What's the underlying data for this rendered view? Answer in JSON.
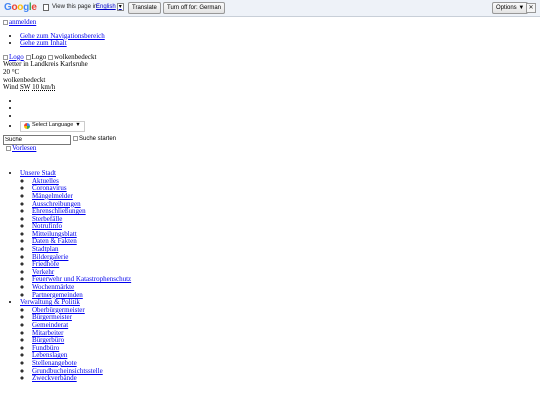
{
  "translate_bar": {
    "logo": "Google",
    "prompt": "View this page in:",
    "language": "English",
    "translate_button": "Translate",
    "turn_off_button": "Turn off for: German",
    "options_button": "Options ▼",
    "close": "✕"
  },
  "top": {
    "login_alt": "anmelden",
    "skip_links": [
      "Gehe zum Navigationsbereich",
      "Gehe zum Inhalt"
    ],
    "logo_alt_1": "Logo",
    "logo_alt_2": "Logo"
  },
  "weather": {
    "icon_alt": "wolkenbedeckt",
    "location": "Wetter in Landkreis Karlsruhe",
    "temperature": "20 °C",
    "condition": "wolkenbedeckt",
    "wind_label": "Wind",
    "wind_dir": "SW",
    "wind_speed": "10 km/h"
  },
  "language_selector": {
    "label": "Select Language",
    "arrow": "▼"
  },
  "search": {
    "value": "Suche",
    "button_alt": "Suche starten"
  },
  "readspeaker_alt": "Vorlesen",
  "nav": {
    "section1": {
      "label": "Unsere Stadt",
      "items": [
        "Aktuelles",
        "Coronavirus",
        "Mängelmelder",
        "Ausschreibungen",
        "Ehrenschließungen",
        "Sterbefälle",
        "Notrufinfo",
        "Mitteilungsblatt",
        "Daten & Fakten",
        "Stadtplan",
        "Bildergalerie",
        "Friedhöfe",
        "Verkehr",
        "Feuerwehr und Katastrophenschutz",
        "Wochenmärkte",
        "Partnergemeinden"
      ]
    },
    "section2": {
      "label": "Verwaltung & Politik",
      "items": [
        "Oberbürgermeister",
        "Bürgermeister",
        "Gemeinderat",
        "Mitarbeiter",
        "Bürgerbüro",
        "Fundbüro",
        "Lebenslagen",
        "Stellenangebote",
        "Grundbucheinsichtsstelle",
        "Zweckverbände"
      ]
    }
  }
}
